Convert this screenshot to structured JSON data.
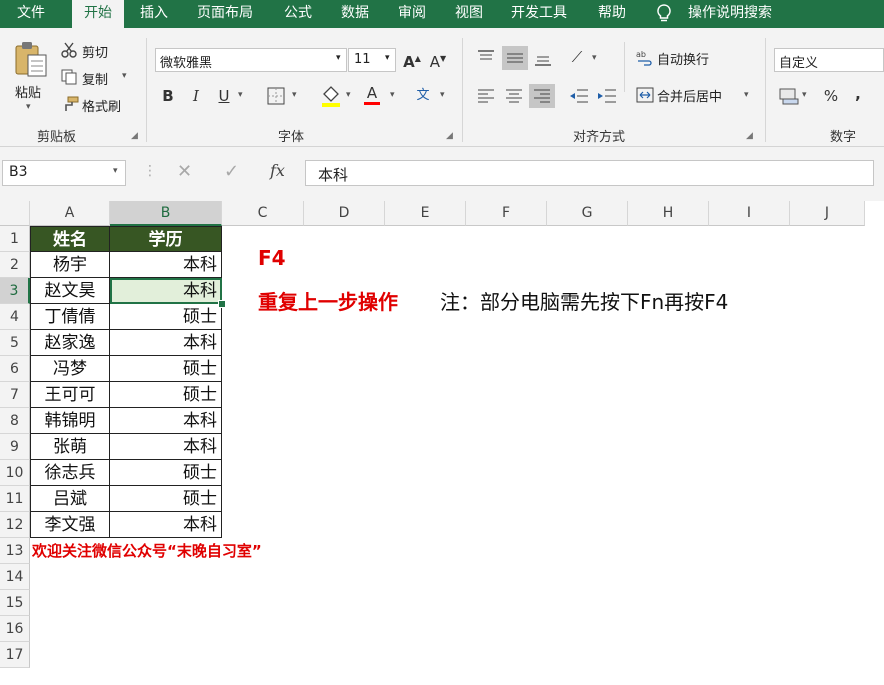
{
  "ribbon_tabs": [
    "文件",
    "开始",
    "插入",
    "页面布局",
    "公式",
    "数据",
    "审阅",
    "视图",
    "开发工具",
    "帮助"
  ],
  "tell_me": "操作说明搜索",
  "clipboard": {
    "paste": "粘贴",
    "cut": "剪切",
    "copy": "复制",
    "format_painter": "格式刷",
    "group": "剪贴板"
  },
  "font": {
    "name": "微软雅黑",
    "size": "11",
    "bold": "B",
    "italic": "I",
    "underline": "U",
    "group": "字体"
  },
  "alignment": {
    "wrap_text": "自动换行",
    "merge_center": "合并后居中",
    "group": "对齐方式"
  },
  "number": {
    "format": "自定义",
    "percent": "%",
    "comma": ",",
    "group": "数字"
  },
  "formula_bar": {
    "name_box": "B3",
    "content": "本科",
    "fx": "fx"
  },
  "columns": [
    "A",
    "B",
    "C",
    "D",
    "E",
    "F",
    "G",
    "H",
    "I",
    "J"
  ],
  "rows": [
    "1",
    "2",
    "3",
    "4",
    "5",
    "6",
    "7",
    "8",
    "9",
    "10",
    "11",
    "12",
    "13",
    "14",
    "15",
    "16",
    "17"
  ],
  "table": {
    "headers": [
      "姓名",
      "学历"
    ],
    "rows": [
      [
        "杨宇",
        "本科"
      ],
      [
        "赵文昊",
        "本科"
      ],
      [
        "丁倩倩",
        "硕士"
      ],
      [
        "赵家逸",
        "本科"
      ],
      [
        "冯梦",
        "硕士"
      ],
      [
        "王可可",
        "硕士"
      ],
      [
        "韩锦明",
        "本科"
      ],
      [
        "张萌",
        "本科"
      ],
      [
        "徐志兵",
        "硕士"
      ],
      [
        "吕斌",
        "硕士"
      ],
      [
        "李文强",
        "本科"
      ]
    ]
  },
  "footer_note": "欢迎关注微信公众号“末晚自习室”",
  "annotation": {
    "key": "F4",
    "action": "重复上一步操作",
    "note": "注：部分电脑需先按下Fn再按F4"
  },
  "colors": {
    "accent": "#217346",
    "header_fill": "#375623",
    "red": "#e00000",
    "selected_fill": "#e2efda"
  },
  "icons": [
    "paste-icon",
    "scissors-icon",
    "copy-icon",
    "format-painter-icon",
    "lightbulb-icon",
    "fill-color-icon",
    "font-color-icon",
    "borders-icon",
    "wrap-text-icon",
    "merge-icon",
    "cancel-icon",
    "enter-icon"
  ]
}
